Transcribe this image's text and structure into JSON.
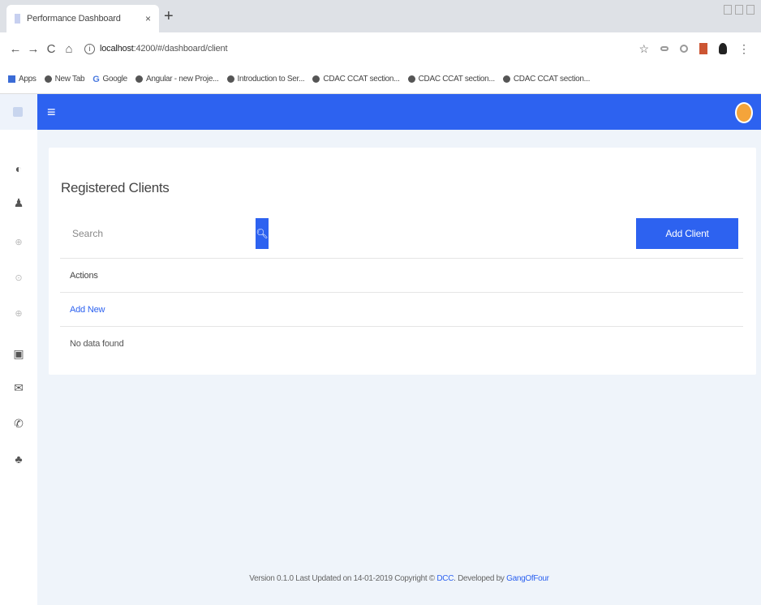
{
  "browser": {
    "tab_title": "Performance Dashboard",
    "tab_close": "×",
    "new_tab": "+",
    "url_host": "localhost",
    "url_path": ":4200/#/dashboard/client",
    "bookmarks": [
      {
        "label": "Apps",
        "icon": "apps-grid-icon"
      },
      {
        "label": "New Tab",
        "icon": "globe-icon"
      },
      {
        "label": "Google",
        "icon": "google-icon"
      },
      {
        "label": "Angular - new Proje...",
        "icon": "globe-icon"
      },
      {
        "label": "Introduction to Ser...",
        "icon": "jb-icon"
      },
      {
        "label": "CDAC CCAT section...",
        "icon": "globe-icon"
      },
      {
        "label": "CDAC CCAT section...",
        "icon": "globe-icon"
      },
      {
        "label": "CDAC CCAT section...",
        "icon": "globe-icon"
      }
    ]
  },
  "app": {
    "accent_color": "#2d62f0",
    "page_bg": "#eff4fa",
    "card": {
      "title": "Registered Clients",
      "search_placeholder": "Search",
      "add_button": "Add Client",
      "table_header": "Actions",
      "add_new_link": "Add New",
      "empty_message": "No data found"
    },
    "footer": {
      "prefix": "Version 0.1.0 Last Updated on 14-01-2019 Copyright © ",
      "org": "DCC",
      "middle": ". Developed by ",
      "team": "GangOfFour"
    }
  }
}
